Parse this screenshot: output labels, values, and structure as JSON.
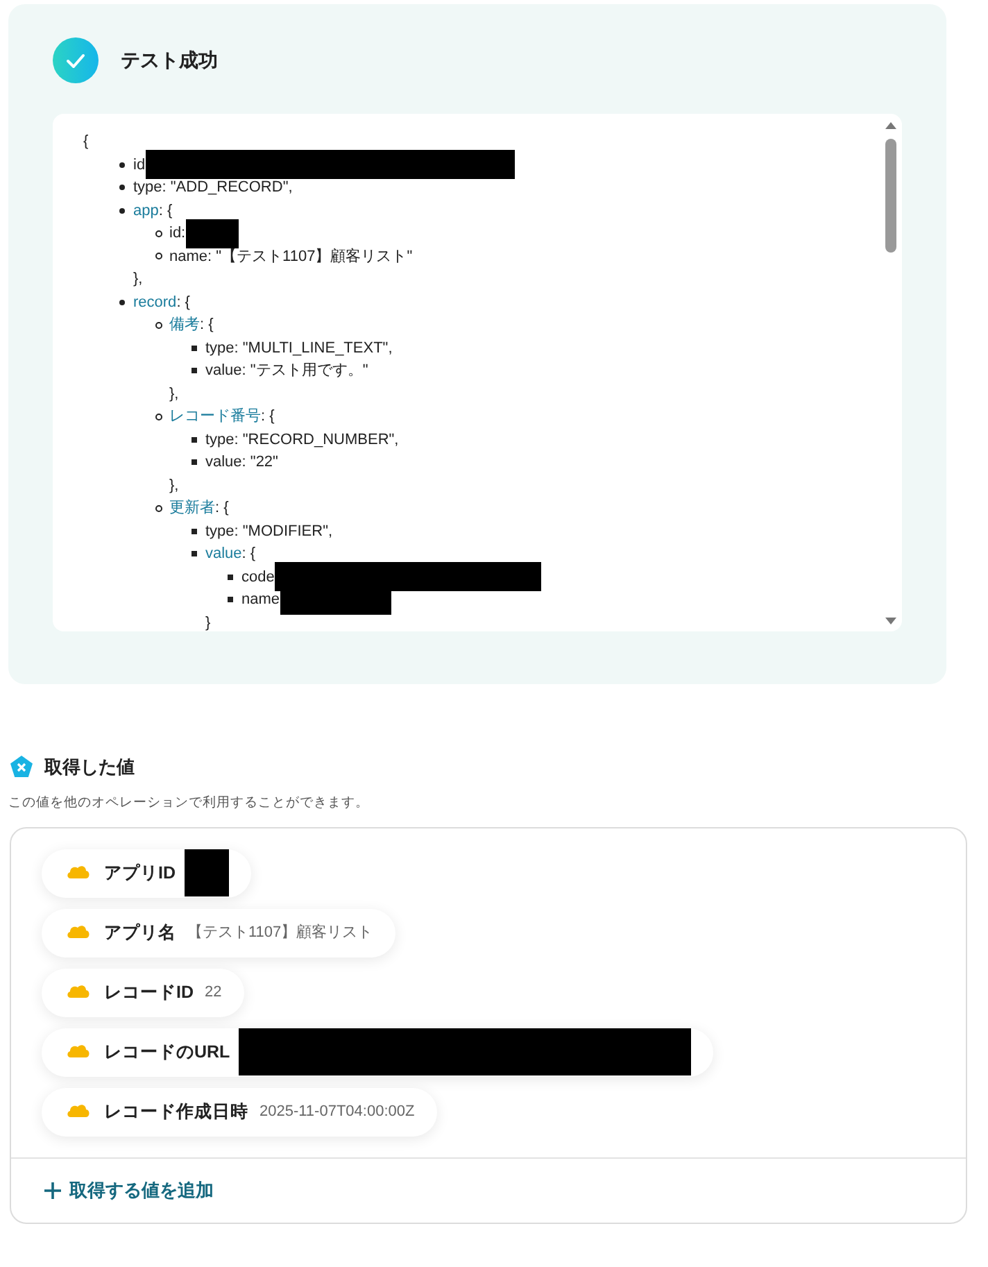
{
  "test_result": {
    "title": "テスト成功",
    "code": {
      "open": "{",
      "children": [
        {
          "kind": "redacted",
          "text": "id"
        },
        {
          "kind": "field",
          "text": "type: \"ADD_RECORD\","
        },
        {
          "kind": "object",
          "key": "app",
          "text": ": {",
          "close": "},",
          "children": [
            {
              "kind": "redacted",
              "text": "id:"
            },
            {
              "kind": "field",
              "text": "name: \"【テスト1107】顧客リスト\""
            }
          ]
        },
        {
          "kind": "object",
          "key": "record",
          "text": ": {",
          "children": [
            {
              "kind": "object",
              "key": "備考",
              "text": ": {",
              "close": "},",
              "children": [
                {
                  "kind": "field",
                  "text": "type: \"MULTI_LINE_TEXT\","
                },
                {
                  "kind": "field",
                  "text": "value: \"テスト用です。\""
                }
              ]
            },
            {
              "kind": "object",
              "key": "レコード番号",
              "text": ": {",
              "close": "},",
              "children": [
                {
                  "kind": "field",
                  "text": "type: \"RECORD_NUMBER\","
                },
                {
                  "kind": "field",
                  "text": "value: \"22\""
                }
              ]
            },
            {
              "kind": "object",
              "key": "更新者",
              "text": ": {",
              "children": [
                {
                  "kind": "field",
                  "text": "type: \"MODIFIER\","
                },
                {
                  "kind": "object",
                  "key": "value",
                  "text": ": {",
                  "close": "}",
                  "children": [
                    {
                      "kind": "redacted",
                      "text": "code"
                    },
                    {
                      "kind": "redacted",
                      "text": "name"
                    }
                  ]
                }
              ]
            }
          ]
        }
      ]
    }
  },
  "obtained_values": {
    "title": "取得した値",
    "description": "この値を他のオペレーションで利用することができます。",
    "items": [
      {
        "label": "アプリID",
        "kind": "redacted"
      },
      {
        "label": "アプリ名",
        "kind": "text",
        "value": "【テスト1107】顧客リスト"
      },
      {
        "label": "レコードID",
        "kind": "text",
        "value": "22"
      },
      {
        "label": "レコードのURL",
        "kind": "redacted"
      },
      {
        "label": "レコード作成日時",
        "kind": "text",
        "value": "2025-11-07T04:00:00Z"
      }
    ],
    "add_button": "取得する値を追加"
  }
}
